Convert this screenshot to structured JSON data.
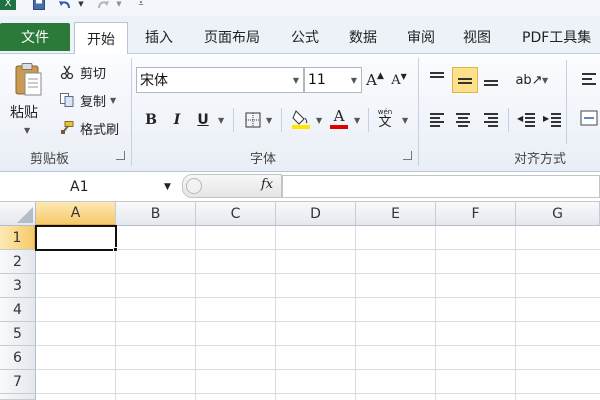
{
  "quick_access": {
    "app_icon": "excel-icon",
    "save_icon": "save-icon",
    "undo_icon": "undo-icon",
    "redo_icon": "redo-icon",
    "customize_icon": "customize-qat-icon"
  },
  "tabs": [
    "文件",
    "开始",
    "插入",
    "页面布局",
    "公式",
    "数据",
    "审阅",
    "视图",
    "PDF工具集"
  ],
  "active_tab": "开始",
  "clipboard": {
    "paste_label": "粘贴",
    "cut_label": "剪切",
    "copy_label": "复制",
    "format_painter_label": "格式刷",
    "group_label": "剪贴板"
  },
  "font": {
    "font_name": "宋体",
    "font_size": "11",
    "grow_label": "A",
    "shrink_label": "A",
    "bold": "B",
    "italic": "I",
    "underline": "U",
    "font_color_label": "A",
    "phonetic_label": "wén",
    "phonetic_char": "文",
    "group_label": "字体",
    "colors": {
      "fill_highlight": "#ffe600",
      "font_color": "#e00000"
    }
  },
  "alignment": {
    "group_label": "对齐方式"
  },
  "formula_bar": {
    "name_box": "A1",
    "fx_label": "fx",
    "formula": ""
  },
  "columns": [
    "A",
    "B",
    "C",
    "D",
    "E",
    "F",
    "G"
  ],
  "rows": [
    "1",
    "2",
    "3",
    "4",
    "5",
    "6",
    "7"
  ],
  "selected_cell": "A1",
  "colors": {
    "file_tab": "#2b7a3a",
    "highlight_button": "#fde08a"
  }
}
